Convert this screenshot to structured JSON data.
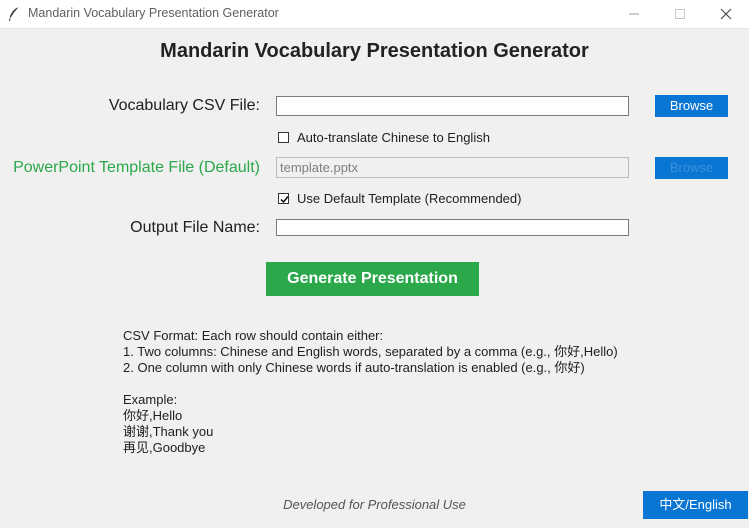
{
  "window": {
    "title": "Mandarin Vocabulary Presentation Generator",
    "app_icon": "feather-icon",
    "controls": [
      "minimize-icon",
      "maximize-icon",
      "close-icon"
    ]
  },
  "heading": "Mandarin Vocabulary Presentation Generator",
  "csv_file": {
    "label": "Vocabulary CSV File:",
    "value": "",
    "browse_label": "Browse"
  },
  "auto_translate": {
    "label": "Auto-translate Chinese to English",
    "checked": false
  },
  "template_file": {
    "label": "PowerPoint Template File (Default)",
    "value": "template.pptx",
    "browse_label": "Browse",
    "disabled": true
  },
  "default_template": {
    "label": "Use Default Template (Recommended)",
    "checked": true
  },
  "output_file": {
    "label": "Output File Name:",
    "value": ""
  },
  "generate_label": "Generate Presentation",
  "info_text": "CSV Format: Each row should contain either:\n1. Two columns: Chinese and English words, separated by a comma (e.g., 你好,Hello)\n2. One column with only Chinese words if auto-translation is enabled (e.g., 你好)\n\nExample:\n你好,Hello\n谢谢,Thank you\n再见,Goodbye",
  "footer": "Developed for Professional Use",
  "language_button": "中文/English",
  "colors": {
    "accent_blue": "#0a76d4",
    "accent_green": "#2aa84a",
    "background": "#f0f0f0"
  }
}
